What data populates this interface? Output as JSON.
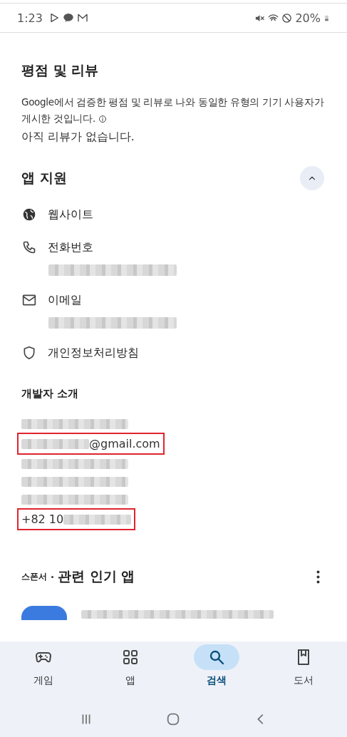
{
  "status_bar": {
    "time": "1:23",
    "battery": "20%"
  },
  "ratings": {
    "title": "평점 및 리뷰",
    "description": "Google에서 검증한 평점 및 리뷰로 나와 동일한 유형의 기기 사용자가 게시한 것입니다.",
    "empty_message": "아직 리뷰가 없습니다."
  },
  "app_support": {
    "title": "앱 지원",
    "expanded": true,
    "items": [
      {
        "kind": "website",
        "label": "웹사이트",
        "value_redacted": false
      },
      {
        "kind": "phone",
        "label": "전화번호",
        "value_redacted": true
      },
      {
        "kind": "email",
        "label": "이메일",
        "value_redacted": true
      },
      {
        "kind": "privacy",
        "label": "개인정보처리방침",
        "value_redacted": false
      }
    ]
  },
  "developer": {
    "title": "개발자 소개",
    "lines": [
      {
        "redacted": true,
        "highlighted": false
      },
      {
        "redacted": true,
        "text_after": "@gmail.com",
        "highlighted": true
      },
      {
        "redacted": true,
        "highlighted": false
      },
      {
        "redacted": true,
        "highlighted": false
      },
      {
        "redacted": true,
        "highlighted": false
      },
      {
        "redacted": true,
        "text_before": "+82 10",
        "highlighted": true
      }
    ]
  },
  "related": {
    "sponsor": "스폰서",
    "title": "관련 인기 앱"
  },
  "bottom_nav": [
    {
      "kind": "games",
      "label": "게임",
      "selected": false
    },
    {
      "kind": "apps",
      "label": "앱",
      "selected": false
    },
    {
      "kind": "search",
      "label": "검색",
      "selected": true
    },
    {
      "kind": "books",
      "label": "도서",
      "selected": false
    }
  ]
}
